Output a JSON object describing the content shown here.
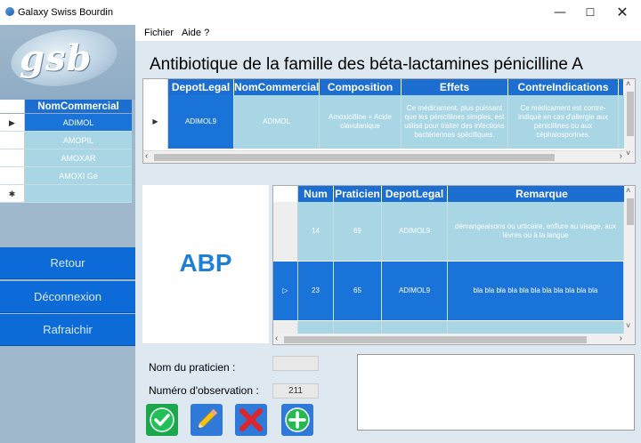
{
  "window": {
    "title": "Galaxy Swiss Bourdin"
  },
  "menu": {
    "items": [
      "Fichier",
      "Aide ?"
    ]
  },
  "logo": {
    "text": "gsb"
  },
  "commerciaux": {
    "header": "NomCommercial",
    "rows": [
      "ADIMOL",
      "AMOPIL",
      "AMOXAR",
      "AMOXI Gé",
      ""
    ]
  },
  "nav": {
    "retour": "Retour",
    "deconnexion": "Déconnexion",
    "rafraichir": "Rafraichir"
  },
  "heading": "Antibiotique de la famille des béta-lactamines pénicilline A",
  "medicaments": {
    "headers": [
      "DepotLegal",
      "NomCommercial",
      "Composition",
      "Effets",
      "ContreIndications"
    ],
    "row": {
      "depot": "ADIMOL9",
      "nom": "ADIMOL",
      "composition": "Amoxicilline + Acide clavulanique",
      "effets": "Ce médicament, plus puissant que les pénicillines simples, est utilisé pour traiter des infections bactériennes spécifiques.",
      "contre": "Ce médicament est contre-indiqué en cas d'allergie aux pénicillines ou aux céphalosporines."
    }
  },
  "image": {
    "label": "ABP"
  },
  "observations": {
    "headers": [
      "Num",
      "Praticien",
      "DepotLegal",
      "Remarque"
    ],
    "rows": [
      {
        "num": "14",
        "praticien": "69",
        "depot": "ADIMOL9",
        "remarque": "démangeaisons ou urticaire, enflure au visage, aux lèvres ou à la langue"
      },
      {
        "num": "23",
        "praticien": "65",
        "depot": "ADIMOL9",
        "remarque": "bla bla bla bla bla bla bla bla bla bla bla"
      }
    ]
  },
  "form": {
    "praticien_label": "Nom du praticien :",
    "praticien_value": "",
    "observation_label": "Numéro d'observation :",
    "observation_value": "211",
    "remarque_value": ""
  },
  "colors": {
    "header_blue": "#1c6fd0",
    "cell_light": "#a9d6e5",
    "selected": "#1a73d8",
    "nav_button": "#0c6bd6"
  },
  "actions": {
    "ok": "check-icon",
    "edit": "pencil-icon",
    "delete": "cross-icon",
    "add": "plus-icon"
  }
}
